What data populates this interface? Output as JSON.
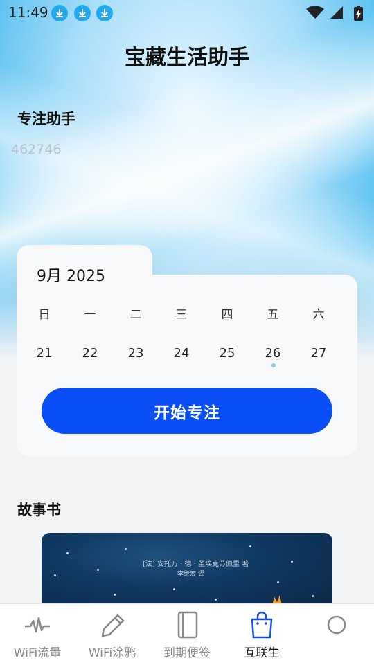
{
  "status_bar": {
    "time": "11:49",
    "download_icons": [
      "download-icon",
      "download-icon",
      "download-icon"
    ],
    "system_icons": [
      "wifi-icon",
      "signal-icon",
      "battery-charging-icon"
    ]
  },
  "app_title": "宝藏生活助手",
  "focus_section": {
    "title": "专注助手",
    "number": "462746"
  },
  "calendar": {
    "month_label": "9月  2025",
    "weekdays": [
      "日",
      "一",
      "二",
      "三",
      "四",
      "五",
      "六"
    ],
    "dates": [
      "21",
      "22",
      "23",
      "24",
      "25",
      "26",
      "27"
    ],
    "today_index": 5,
    "start_button_label": "开始专注"
  },
  "story_section": {
    "title": "故事书",
    "book_author_line": "[法] 安托万 · 德 · 圣埃克苏佩里 著",
    "book_translator_line": "李继宏 译"
  },
  "tab_bar": {
    "tabs": [
      {
        "label": "WiFi流量",
        "icon": "pulse-icon",
        "active": false
      },
      {
        "label": "WiFi涂鸦",
        "icon": "pencil-icon",
        "active": false
      },
      {
        "label": "到期便签",
        "icon": "note-icon",
        "active": false
      },
      {
        "label": "互联生",
        "icon": "shopping-bag-icon",
        "active": true
      },
      {
        "label": "",
        "icon": "user-icon",
        "active": false
      }
    ]
  },
  "colors": {
    "accent": "#0a4ff5",
    "hero_sky": "#4bbcf0",
    "download_badge": "#22a9f0"
  }
}
